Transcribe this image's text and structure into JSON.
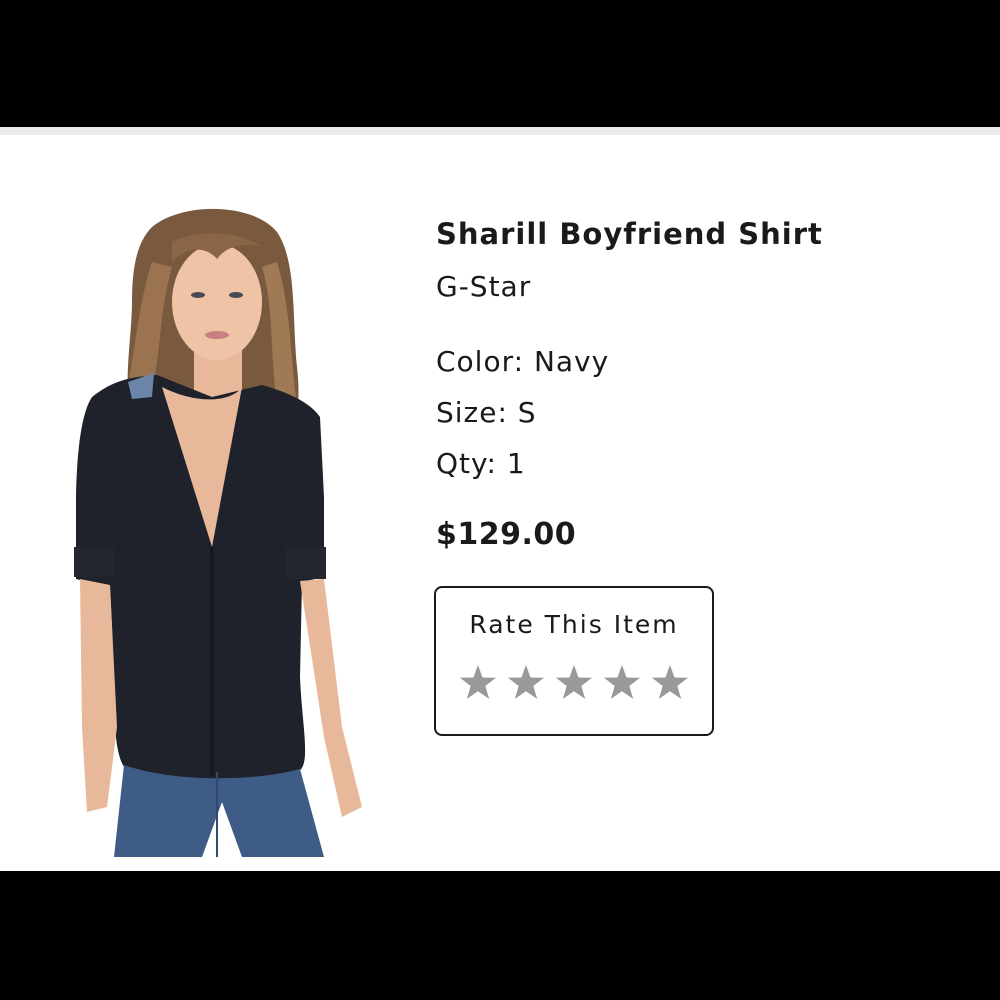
{
  "product": {
    "title": "Sharill Boyfriend Shirt",
    "brand": "G-Star",
    "color_label": "Color: Navy",
    "size_label": "Size: S",
    "qty_label": "Qty: 1",
    "price": "$129.00",
    "image_alt_icon": "product-photo"
  },
  "rating": {
    "title": "Rate This Item",
    "stars": [
      {
        "icon": "star-icon",
        "glyph": "★"
      },
      {
        "icon": "star-icon",
        "glyph": "★"
      },
      {
        "icon": "star-icon",
        "glyph": "★"
      },
      {
        "icon": "star-icon",
        "glyph": "★"
      },
      {
        "icon": "star-icon",
        "glyph": "★"
      }
    ],
    "selected_rating": 0,
    "star_color": "#999999"
  },
  "colors": {
    "background": "#ffffff",
    "frame": "#000000",
    "text": "#1a1a1a",
    "shirt": "#1f222b",
    "jeans": "#3f5c87"
  }
}
